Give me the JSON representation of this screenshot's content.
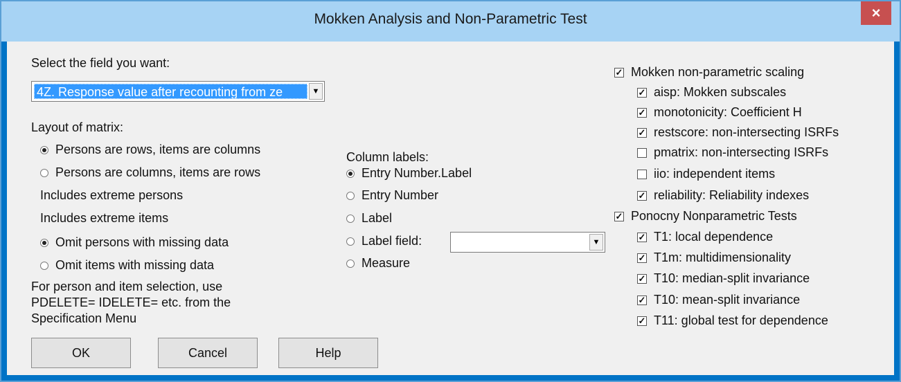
{
  "window": {
    "title": "Mokken Analysis and Non-Parametric Test",
    "close_glyph": "×"
  },
  "field_select": {
    "label": "Select the field you want:",
    "value": "4Z. Response value after recounting from ze"
  },
  "layout": {
    "label": "Layout of matrix:",
    "options": [
      {
        "label": "Persons are rows, items are columns",
        "selected": true
      },
      {
        "label": "Persons are columns, items are rows",
        "selected": false
      }
    ]
  },
  "extremes": {
    "persons": "Includes extreme persons",
    "items": "Includes extreme items"
  },
  "missing": {
    "options": [
      {
        "label": "Omit persons with missing data",
        "selected": true
      },
      {
        "label": "Omit items with missing data",
        "selected": false
      }
    ]
  },
  "note": {
    "line1": "For person and item selection, use",
    "line2": "PDELETE= IDELETE= etc. from the",
    "line3": "Specification Menu"
  },
  "column_labels": {
    "label": "Column labels:",
    "options": [
      {
        "label": "Entry Number.Label",
        "selected": true
      },
      {
        "label": "Entry Number",
        "selected": false
      },
      {
        "label": "Label",
        "selected": false
      },
      {
        "label": "Label field:",
        "selected": false
      },
      {
        "label": "Measure",
        "selected": false
      }
    ],
    "label_field_value": ""
  },
  "mokken": {
    "label": "Mokken non-parametric scaling",
    "checked": true,
    "items": [
      {
        "label": "aisp: Mokken subscales",
        "checked": true
      },
      {
        "label": "monotonicity: Coefficient H",
        "checked": true
      },
      {
        "label": "restscore: non-intersecting ISRFs",
        "checked": true
      },
      {
        "label": "pmatrix: non-intersecting ISRFs",
        "checked": false
      },
      {
        "label": "iio: independent items",
        "checked": false
      },
      {
        "label": "reliability: Reliability indexes",
        "checked": true
      }
    ]
  },
  "ponocny": {
    "label": "Ponocny Nonparametric Tests",
    "checked": true,
    "items": [
      {
        "label": "T1: local dependence",
        "checked": true
      },
      {
        "label": "T1m: multidimensionality",
        "checked": true
      },
      {
        "label": "T10: median-split invariance",
        "checked": true
      },
      {
        "label": "T10: mean-split invariance",
        "checked": true
      },
      {
        "label": "T11: global test for dependence",
        "checked": true
      }
    ]
  },
  "buttons": {
    "ok": "OK",
    "cancel": "Cancel",
    "help": "Help"
  },
  "colors": {
    "titlebar": "#a7d3f4",
    "close": "#c75050",
    "selection": "#3399ff",
    "client": "#f0f0f0"
  }
}
